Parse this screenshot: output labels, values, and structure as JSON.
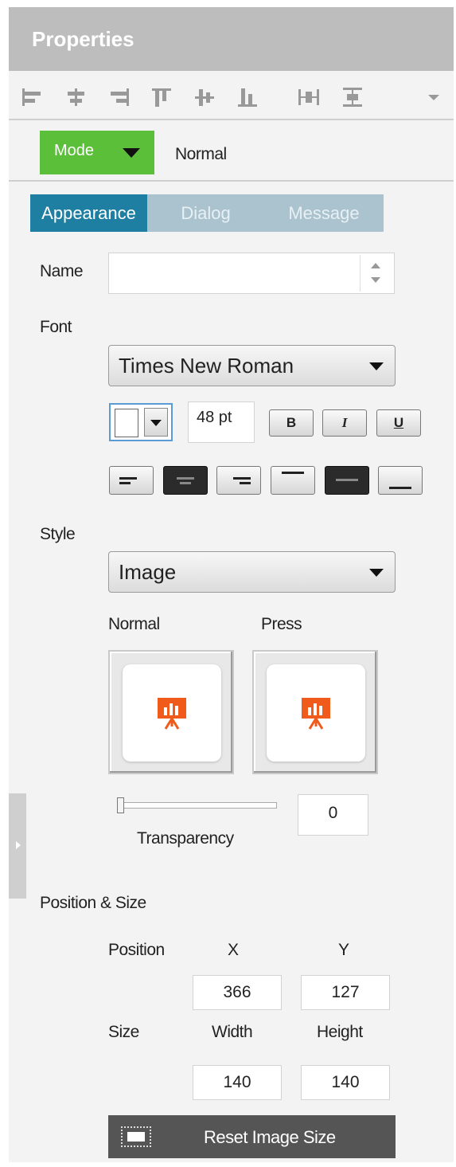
{
  "header": {
    "title": "Properties"
  },
  "toolbar": {
    "icons": [
      "align-left-icon",
      "align-center-icon",
      "align-right-icon",
      "align-top-icon",
      "align-middle-icon",
      "align-bottom-icon",
      "distribute-horizontal-icon",
      "distribute-vertical-icon",
      "more-options-icon"
    ]
  },
  "mode": {
    "button_label": "Mode",
    "value": "Normal",
    "accent": "#5cbf3a"
  },
  "tabs": [
    {
      "label": "Appearance",
      "active": true
    },
    {
      "label": "Dialog",
      "active": false
    },
    {
      "label": "Message",
      "active": false
    }
  ],
  "fields": {
    "name": {
      "label": "Name",
      "value": ""
    },
    "font": {
      "label": "Font",
      "family": "Times New Roman",
      "size": "48 pt",
      "color": "#ffffff",
      "bold_label": "B",
      "italic_label": "I",
      "underline_label": "U"
    },
    "style": {
      "label": "Style",
      "value": "Image",
      "normal_label": "Normal",
      "press_label": "Press"
    },
    "transparency": {
      "label": "Transparency",
      "value": "0"
    }
  },
  "position_size": {
    "section_label": "Position & Size",
    "position_label": "Position",
    "size_label": "Size",
    "x_label": "X",
    "y_label": "Y",
    "width_label": "Width",
    "height_label": "Height",
    "x": "366",
    "y": "127",
    "width": "140",
    "height": "140"
  },
  "reset_button": {
    "label": "Reset Image Size"
  },
  "colors": {
    "tab_active": "#1e7fa3",
    "tab_inactive": "#aac3cf",
    "presentation_icon": "#f05a1a"
  }
}
